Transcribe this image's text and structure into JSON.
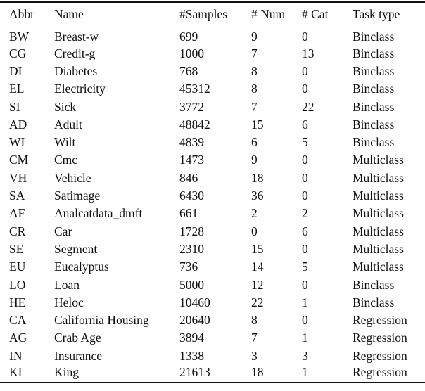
{
  "table": {
    "headers": [
      "Abbr",
      "Name",
      "#Samples",
      "# Num",
      "# Cat",
      "Task type"
    ],
    "rows": [
      {
        "abbr": "BW",
        "name": "Breast-w",
        "samples": "699",
        "num": "9",
        "cat": "0",
        "task": "Binclass"
      },
      {
        "abbr": "CG",
        "name": "Credit-g",
        "samples": "1000",
        "num": "7",
        "cat": "13",
        "task": "Binclass"
      },
      {
        "abbr": "DI",
        "name": "Diabetes",
        "samples": "768",
        "num": "8",
        "cat": "0",
        "task": "Binclass"
      },
      {
        "abbr": "EL",
        "name": "Electricity",
        "samples": "45312",
        "num": "8",
        "cat": "0",
        "task": "Binclass"
      },
      {
        "abbr": "SI",
        "name": "Sick",
        "samples": "3772",
        "num": "7",
        "cat": "22",
        "task": "Binclass"
      },
      {
        "abbr": "AD",
        "name": "Adult",
        "samples": "48842",
        "num": "15",
        "cat": "6",
        "task": "Binclass"
      },
      {
        "abbr": "WI",
        "name": "Wilt",
        "samples": "4839",
        "num": "6",
        "cat": "5",
        "task": "Binclass"
      },
      {
        "abbr": "CM",
        "name": "Cmc",
        "samples": "1473",
        "num": "9",
        "cat": "0",
        "task": "Multiclass"
      },
      {
        "abbr": "VH",
        "name": "Vehicle",
        "samples": "846",
        "num": "18",
        "cat": "0",
        "task": "Multiclass"
      },
      {
        "abbr": "SA",
        "name": "Satimage",
        "samples": "6430",
        "num": "36",
        "cat": "0",
        "task": "Multiclass"
      },
      {
        "abbr": "AF",
        "name": "Analcatdata_dmft",
        "samples": "661",
        "num": "2",
        "cat": "2",
        "task": "Multiclass"
      },
      {
        "abbr": "CR",
        "name": "Car",
        "samples": "1728",
        "num": "0",
        "cat": "6",
        "task": "Multiclass"
      },
      {
        "abbr": "SE",
        "name": "Segment",
        "samples": "2310",
        "num": "15",
        "cat": "0",
        "task": "Multiclass"
      },
      {
        "abbr": "EU",
        "name": "Eucalyptus",
        "samples": "736",
        "num": "14",
        "cat": "5",
        "task": "Multiclass"
      },
      {
        "abbr": "LO",
        "name": "Loan",
        "samples": "5000",
        "num": "12",
        "cat": "0",
        "task": "Binclass"
      },
      {
        "abbr": "HE",
        "name": "Heloc",
        "samples": "10460",
        "num": "22",
        "cat": "1",
        "task": "Binclass"
      },
      {
        "abbr": "CA",
        "name": "California Housing",
        "samples": "20640",
        "num": "8",
        "cat": "0",
        "task": "Regression"
      },
      {
        "abbr": "AG",
        "name": "Crab Age",
        "samples": "3894",
        "num": "7",
        "cat": "1",
        "task": "Regression"
      },
      {
        "abbr": "IN",
        "name": "Insurance",
        "samples": "1338",
        "num": "3",
        "cat": "3",
        "task": "Regression"
      },
      {
        "abbr": "KI",
        "name": "King",
        "samples": "21613",
        "num": "18",
        "cat": "1",
        "task": "Regression"
      }
    ]
  }
}
